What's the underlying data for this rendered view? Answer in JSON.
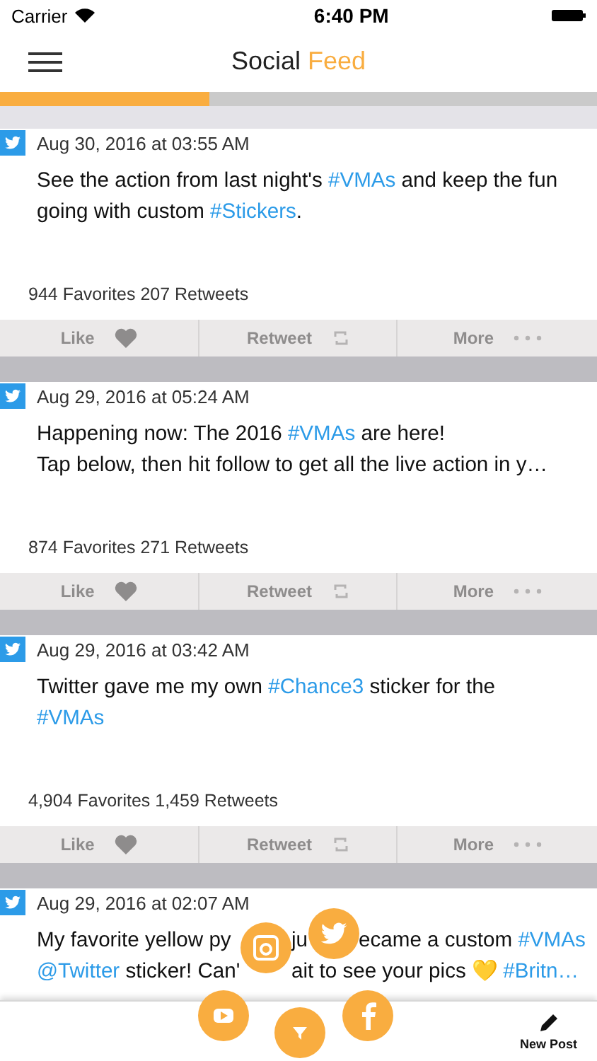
{
  "status_bar": {
    "carrier": "Carrier",
    "time": "6:40 PM"
  },
  "nav": {
    "title": "Social",
    "title_accent": "Feed"
  },
  "progress": {
    "level": 0.35
  },
  "posts": [
    {
      "date": "Aug 30, 2016 at 03:55 AM",
      "lines": [
        [
          {
            "kind": "plain",
            "text": "See the action from last night's "
          },
          {
            "kind": "tag",
            "text": "#VMAs"
          },
          {
            "kind": "plain",
            "text": " and keep the fun"
          }
        ],
        [
          {
            "kind": "plain",
            "text": "going with custom "
          },
          {
            "kind": "tag",
            "text": "#Stickers"
          },
          {
            "kind": "plain",
            "text": "."
          }
        ]
      ],
      "stats": "944 Favorites 207 Retweets",
      "actions": [
        "Like",
        "Retweet",
        "More"
      ]
    },
    {
      "date": "Aug 29, 2016 at 05:24 AM",
      "lines": [
        [
          {
            "kind": "plain",
            "text": "Happening now: The 2016 "
          },
          {
            "kind": "tag",
            "text": "#VMAs"
          },
          {
            "kind": "plain",
            "text": " are here!"
          }
        ],
        [
          {
            "kind": "plain",
            "text": "Tap below, then hit follow to get all the live action in y…"
          }
        ]
      ],
      "stats": "874 Favorites 271 Retweets",
      "actions": [
        "Like",
        "Retweet",
        "More"
      ]
    },
    {
      "date": "Aug 29, 2016 at 03:42 AM",
      "lines": [
        [
          {
            "kind": "plain",
            "text": "Twitter gave me my own "
          },
          {
            "kind": "tag",
            "text": "#Chance3"
          },
          {
            "kind": "plain",
            "text": " sticker for the"
          }
        ],
        [
          {
            "kind": "tag",
            "text": "#VMAs"
          }
        ]
      ],
      "stats": "4,904 Favorites 1,459 Retweets",
      "actions": [
        "Like",
        "Retweet",
        "More"
      ]
    },
    {
      "date": "Aug 29, 2016 at 02:07 AM",
      "covered_lines": [
        [
          [
            {
              "kind": "plain",
              "text": "My favorite yellow py"
            }
          ],
          [
            {
              "kind": "plain",
              "text": "ju"
            }
          ],
          [
            {
              "kind": "plain",
              "text": "ecame a custom "
            },
            {
              "kind": "tag",
              "text": "#VMAs"
            }
          ]
        ],
        [
          [
            {
              "kind": "tag",
              "text": "@Twitter"
            },
            {
              "kind": "plain",
              "text": " sticker! Can'"
            }
          ],
          [
            {
              "kind": "plain",
              "text": "ait to see your pics 💛 "
            },
            {
              "kind": "tag",
              "text": "#Britn…"
            }
          ]
        ]
      ]
    }
  ],
  "toolbar": {
    "new_post": "New Post"
  }
}
